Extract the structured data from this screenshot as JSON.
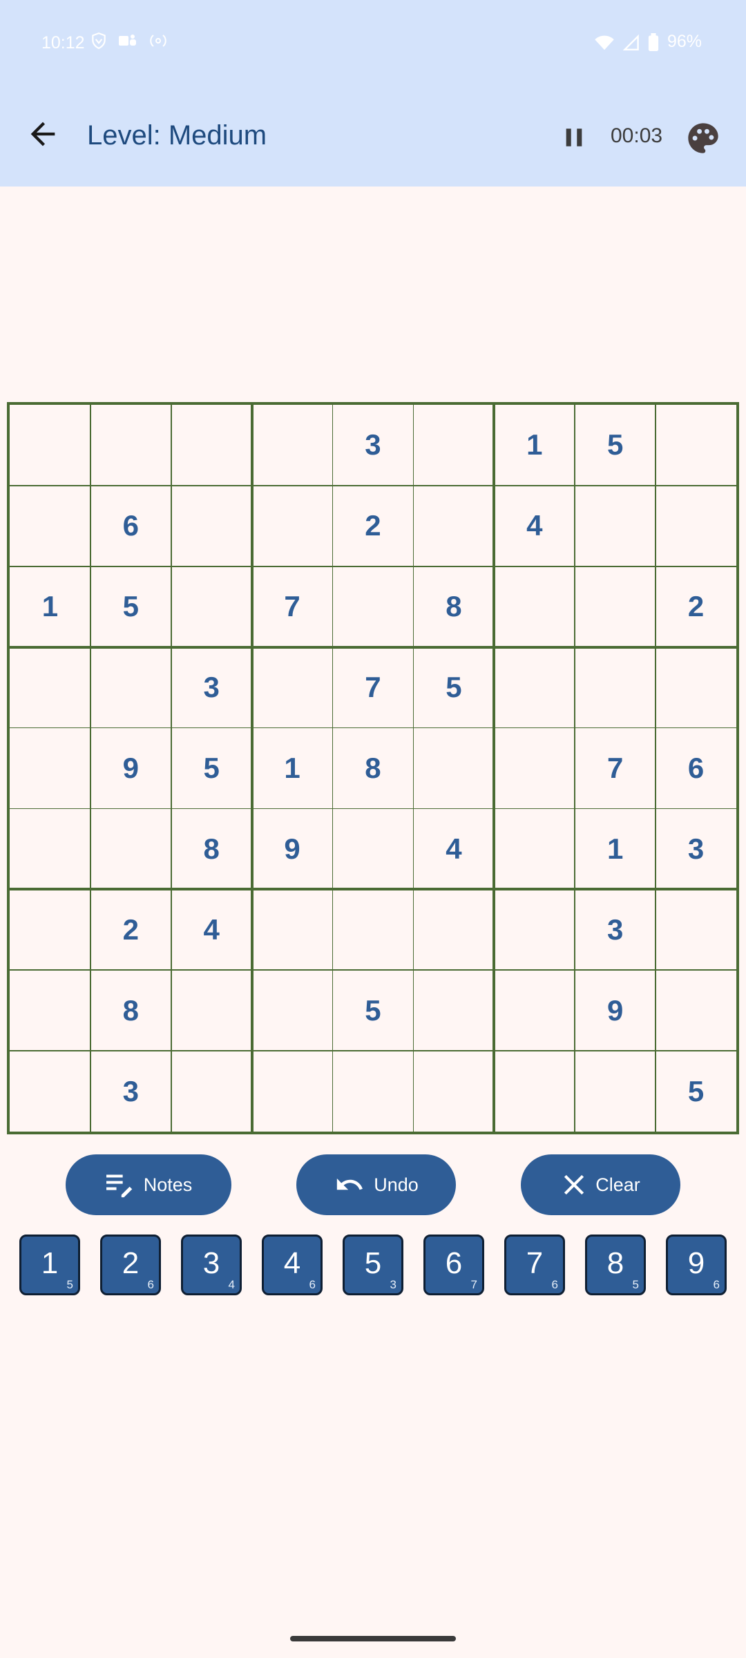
{
  "status_bar": {
    "time": "10:12",
    "battery": "96%"
  },
  "header": {
    "title": "Level: Medium",
    "timer": "00:03"
  },
  "colors": {
    "accent": "#2F5D96",
    "header_bg": "#D4E3FB",
    "grid_line": "#4A6B33",
    "background": "#FFF6F4"
  },
  "board": [
    [
      "",
      "",
      "",
      "",
      "3",
      "",
      "1",
      "5",
      ""
    ],
    [
      "",
      "6",
      "",
      "",
      "2",
      "",
      "4",
      "",
      ""
    ],
    [
      "1",
      "5",
      "",
      "7",
      "",
      "8",
      "",
      "",
      "2"
    ],
    [
      "",
      "",
      "3",
      "",
      "7",
      "5",
      "",
      "",
      ""
    ],
    [
      "",
      "9",
      "5",
      "1",
      "8",
      "",
      "",
      "7",
      "6"
    ],
    [
      "",
      "",
      "8",
      "9",
      "",
      "4",
      "",
      "1",
      "3"
    ],
    [
      "",
      "2",
      "4",
      "",
      "",
      "",
      "",
      "3",
      ""
    ],
    [
      "",
      "8",
      "",
      "",
      "5",
      "",
      "",
      "9",
      ""
    ],
    [
      "",
      "3",
      "",
      "",
      "",
      "",
      "",
      "",
      "5"
    ]
  ],
  "actions": {
    "notes_label": "Notes",
    "undo_label": "Undo",
    "clear_label": "Clear"
  },
  "numpad": [
    {
      "digit": "1",
      "count": "5"
    },
    {
      "digit": "2",
      "count": "6"
    },
    {
      "digit": "3",
      "count": "4"
    },
    {
      "digit": "4",
      "count": "6"
    },
    {
      "digit": "5",
      "count": "3"
    },
    {
      "digit": "6",
      "count": "7"
    },
    {
      "digit": "7",
      "count": "6"
    },
    {
      "digit": "8",
      "count": "5"
    },
    {
      "digit": "9",
      "count": "6"
    }
  ],
  "icons": {
    "back": "arrow-back-icon",
    "pause": "pause-icon",
    "palette": "palette-icon",
    "notes": "edit-notes-icon",
    "undo": "undo-icon",
    "clear": "close-icon"
  }
}
